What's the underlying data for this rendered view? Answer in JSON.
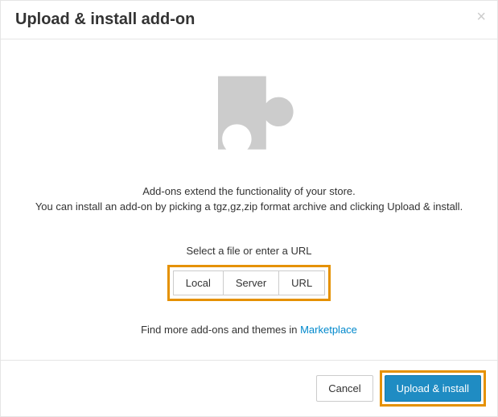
{
  "header": {
    "title": "Upload & install add-on"
  },
  "body": {
    "line1": "Add-ons extend the functionality of your store.",
    "line2": "You can install an add-on by picking a tgz,gz,zip format archive and clicking Upload & install.",
    "select_label": "Select a file or enter a URL",
    "buttons": {
      "local": "Local",
      "server": "Server",
      "url": "URL"
    },
    "marketplace_prefix": "Find more add-ons and themes in ",
    "marketplace_link": "Marketplace"
  },
  "footer": {
    "cancel": "Cancel",
    "submit": "Upload & install"
  }
}
